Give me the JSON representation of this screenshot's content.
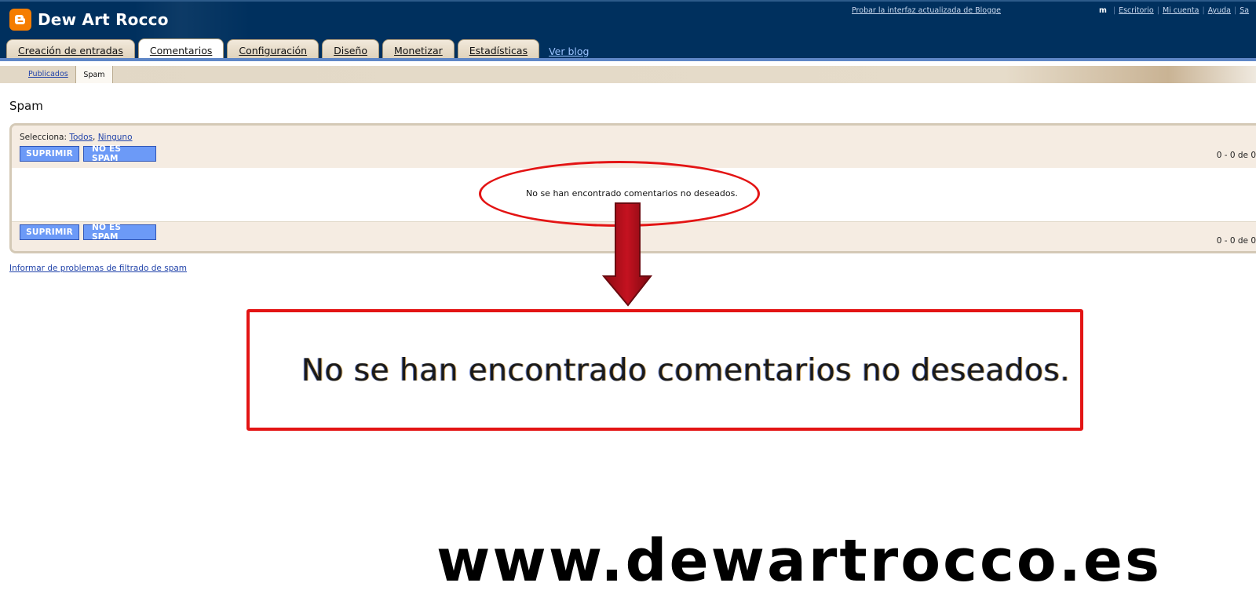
{
  "header": {
    "blog_title": "Dew Art Rocco",
    "try_new_interface": "Probar la interfaz actualizada de Blogge",
    "user_fragment": "m",
    "links": [
      "Escritorio",
      "Mi cuenta",
      "Ayuda",
      "Sa"
    ]
  },
  "tabs": [
    {
      "label": "Creación de entradas",
      "active": false
    },
    {
      "label": "Comentarios",
      "active": true
    },
    {
      "label": "Configuración",
      "active": false
    },
    {
      "label": "Diseño",
      "active": false
    },
    {
      "label": "Monetizar",
      "active": false
    },
    {
      "label": "Estadísticas",
      "active": false
    }
  ],
  "view_blog": "Ver blog",
  "subnav": {
    "published": "Publicados",
    "spam": "Spam"
  },
  "page_title": "Spam",
  "spam_box": {
    "select_label": "Selecciona:",
    "select_all": "Todos",
    "select_none": "Ninguno",
    "delete_button": "SUPRIMIR",
    "not_spam_button": "NO ES SPAM",
    "count": "0 - 0 de 0",
    "empty_message": "No se han encontrado comentarios no deseados."
  },
  "report_link": "Informar de problemas de filtrado de spam",
  "annotation": {
    "zoom_text": "No se han encontrado comentarios no deseados.",
    "watermark": "www.dewartrocco.es"
  },
  "colors": {
    "header_bg": "#00305e",
    "logo_orange": "#f57d00",
    "button_blue": "#6c9af7",
    "annotation_red": "#e31414"
  }
}
